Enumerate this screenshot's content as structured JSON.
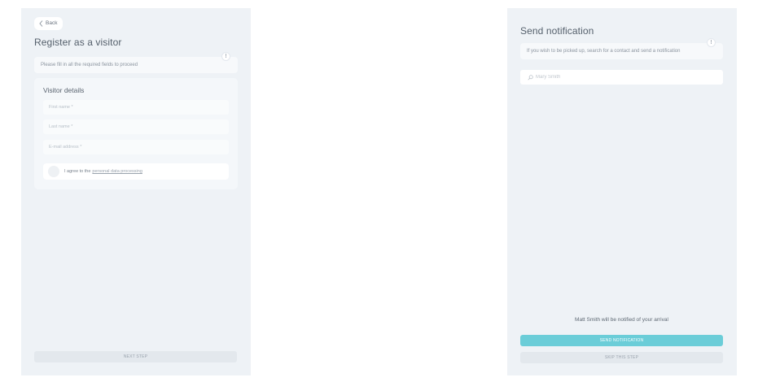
{
  "visitor": {
    "back_label": "Back",
    "title": "Register as a visitor",
    "info_text": "Please fill in all the required fields to proceed",
    "info_icon": "!",
    "details_title": "Visitor details",
    "fields": {
      "first_name_placeholder": "First name *",
      "last_name_placeholder": "Last name *",
      "email_placeholder": "E-mail address *"
    },
    "consent_text": "I agree to the",
    "consent_link": "personal data processing",
    "next_step_label": "NEXT STEP"
  },
  "notification": {
    "title": "Send notification",
    "info_text": "If you wish to be picked up, search for a contact and send a notification",
    "info_icon": "!",
    "search_placeholder": "Mary Smith",
    "notify_message": "Matt Smith will be notified of your arrival",
    "send_label": "SEND NOTIFICATION",
    "skip_label": "SKIP THIS STEP"
  },
  "icons": {
    "back": "chevron-left-icon",
    "info": "exclamation-icon",
    "search": "search-icon"
  },
  "colors": {
    "panel_bg": "#eef2f6",
    "accent": "#6bcdd8"
  }
}
